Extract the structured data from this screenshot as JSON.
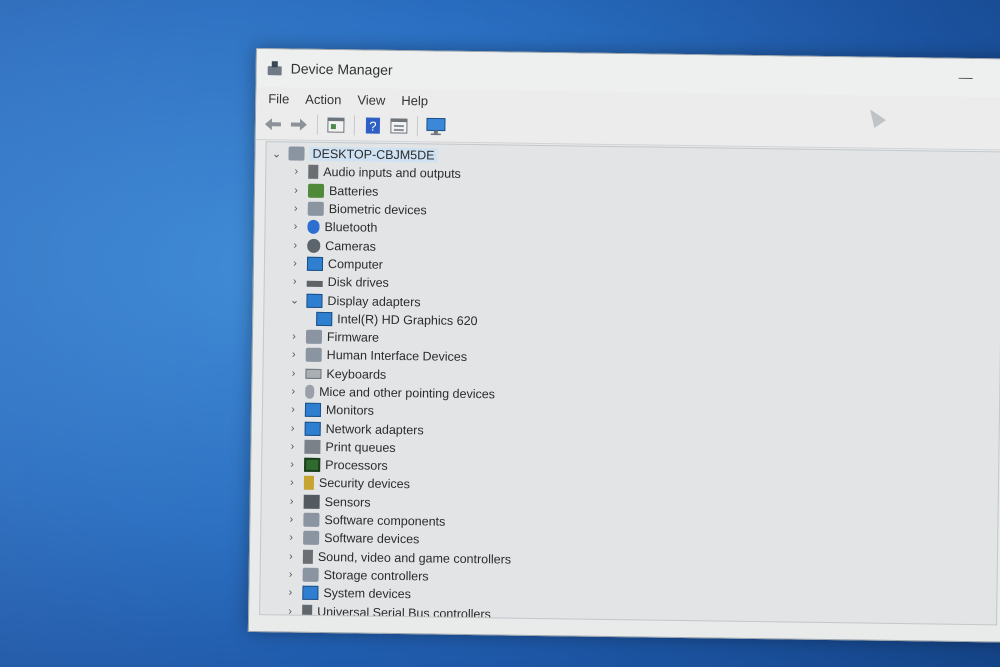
{
  "window": {
    "title": "Device Manager",
    "minimize": "—"
  },
  "menu": [
    "File",
    "Action",
    "View",
    "Help"
  ],
  "toolbar": [
    {
      "name": "back-arrow-icon",
      "glyph": "⇦"
    },
    {
      "name": "forward-arrow-icon",
      "glyph": "⇨"
    },
    {
      "name": "properties-icon",
      "glyph": "▤"
    },
    {
      "name": "help-icon",
      "glyph": "?"
    },
    {
      "name": "view-icon",
      "glyph": "▦"
    },
    {
      "name": "scan-monitor-icon",
      "glyph": "▭"
    }
  ],
  "tree": {
    "root": "DESKTOP-CBJM5DE",
    "categories": [
      {
        "label": "Audio inputs and outputs",
        "icon": "speaker-icon"
      },
      {
        "label": "Batteries",
        "icon": "battery-icon"
      },
      {
        "label": "Biometric devices",
        "icon": "biometric-icon"
      },
      {
        "label": "Bluetooth",
        "icon": "bluetooth-icon"
      },
      {
        "label": "Cameras",
        "icon": "camera-icon"
      },
      {
        "label": "Computer",
        "icon": "monitor-icon"
      },
      {
        "label": "Disk drives",
        "icon": "disk-icon"
      },
      {
        "label": "Display adapters",
        "icon": "display-adapter-icon",
        "expanded": true,
        "children": [
          "Intel(R) HD Graphics 620"
        ]
      },
      {
        "label": "Firmware",
        "icon": "firmware-icon"
      },
      {
        "label": "Human Interface Devices",
        "icon": "hid-icon"
      },
      {
        "label": "Keyboards",
        "icon": "keyboard-icon"
      },
      {
        "label": "Mice and other pointing devices",
        "icon": "mouse-icon"
      },
      {
        "label": "Monitors",
        "icon": "monitor-icon"
      },
      {
        "label": "Network adapters",
        "icon": "network-icon"
      },
      {
        "label": "Print queues",
        "icon": "printer-icon"
      },
      {
        "label": "Processors",
        "icon": "chip-icon"
      },
      {
        "label": "Security devices",
        "icon": "key-icon"
      },
      {
        "label": "Sensors",
        "icon": "sensor-icon"
      },
      {
        "label": "Software components",
        "icon": "software-component-icon"
      },
      {
        "label": "Software devices",
        "icon": "software-device-icon"
      },
      {
        "label": "Sound, video and game controllers",
        "icon": "speaker-icon"
      },
      {
        "label": "Storage controllers",
        "icon": "storage-icon"
      },
      {
        "label": "System devices",
        "icon": "system-icon"
      },
      {
        "label": "Universal Serial Bus controllers",
        "icon": "usb-icon"
      }
    ]
  },
  "colors": {
    "desktop": "#2a6fc2",
    "selection": "#cfe2f3",
    "window": "#e9eaea"
  }
}
